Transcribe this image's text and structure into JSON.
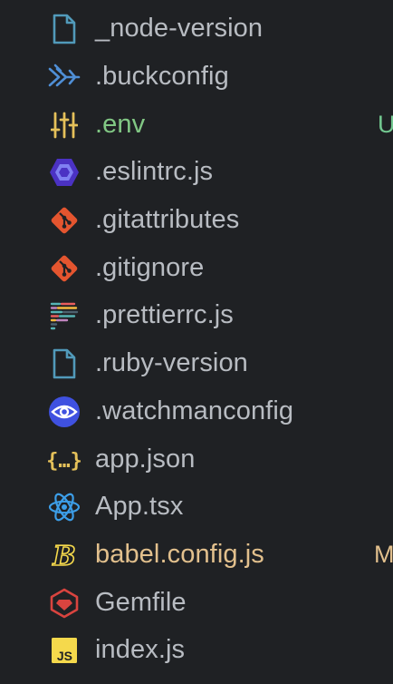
{
  "files": [
    {
      "name": "_node-version",
      "icon": "file-icon",
      "state": "normal",
      "status": ""
    },
    {
      "name": ".buckconfig",
      "icon": "buck-icon",
      "state": "normal",
      "status": ""
    },
    {
      "name": ".env",
      "icon": "env-settings-icon",
      "state": "untracked",
      "status": "U"
    },
    {
      "name": ".eslintrc.js",
      "icon": "eslint-icon",
      "state": "normal",
      "status": ""
    },
    {
      "name": ".gitattributes",
      "icon": "git-icon",
      "state": "normal",
      "status": ""
    },
    {
      "name": ".gitignore",
      "icon": "git-icon",
      "state": "normal",
      "status": ""
    },
    {
      "name": ".prettierrc.js",
      "icon": "prettier-icon",
      "state": "normal",
      "status": ""
    },
    {
      "name": ".ruby-version",
      "icon": "file-icon",
      "state": "normal",
      "status": ""
    },
    {
      "name": ".watchmanconfig",
      "icon": "watchman-eye-icon",
      "state": "normal",
      "status": ""
    },
    {
      "name": "app.json",
      "icon": "json-braces-icon",
      "state": "normal",
      "status": ""
    },
    {
      "name": "App.tsx",
      "icon": "react-atom-icon",
      "state": "normal",
      "status": ""
    },
    {
      "name": "babel.config.js",
      "icon": "babel-icon",
      "state": "modified",
      "status": "M"
    },
    {
      "name": "Gemfile",
      "icon": "ruby-gem-icon",
      "state": "normal",
      "status": ""
    },
    {
      "name": "index.js",
      "icon": "javascript-icon",
      "state": "normal",
      "status": ""
    }
  ],
  "colors": {
    "background": "#1f2124",
    "text": "#b8bcc2",
    "untracked": "#73c991",
    "modified": "#e2c08d"
  }
}
